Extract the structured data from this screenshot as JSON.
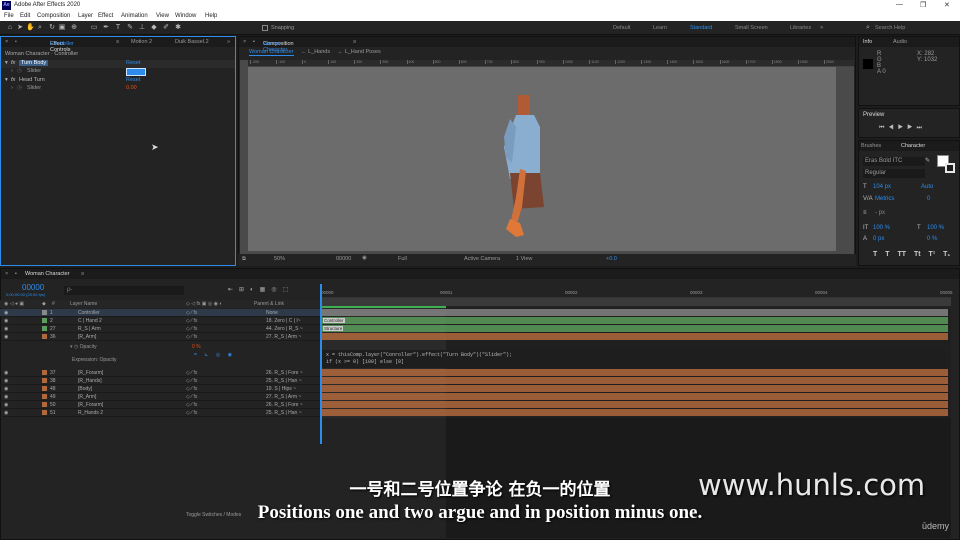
{
  "window": {
    "title": "Adobe After Effects 2020",
    "logo": "Ae"
  },
  "menu": [
    "File",
    "Edit",
    "Composition",
    "Layer",
    "Effect",
    "Animation",
    "View",
    "Window",
    "Help"
  ],
  "toolbar": {
    "snapping_label": "Snapping",
    "workspaces": [
      "Default",
      "Learn",
      "Standard",
      "Small Screen",
      "Libraries"
    ],
    "active_workspace": "Standard",
    "search_placeholder": "Search Help"
  },
  "effect_controls": {
    "tab_prefix": "Effect Controls",
    "tab_layer": "Controller",
    "other_tabs": [
      "Motion 2",
      "Duik Bassel.2"
    ],
    "breadcrumb": "Woman Character · Controller",
    "rows": [
      {
        "label": "Turn Body",
        "value": "Reset"
      },
      {
        "label": "Slider",
        "value": ""
      },
      {
        "label": "Head Turn",
        "value": "Reset"
      },
      {
        "label": "Slider",
        "value": "0.00"
      }
    ]
  },
  "composition": {
    "tab_prefix": "Composition",
    "tab_name": "Woman Character",
    "breadcrumbs": [
      "Woman Character",
      "L_Hands",
      "L_Hand Poses"
    ],
    "ruler_ticks": [
      "-200",
      "-100",
      "0",
      "100",
      "200",
      "300",
      "400",
      "500",
      "600",
      "700",
      "800",
      "900",
      "1000",
      "1100",
      "1200",
      "1300",
      "1400",
      "1500",
      "1600",
      "1700",
      "1800",
      "1900",
      "2000"
    ],
    "footer": {
      "zoom": "50%",
      "time": "00000",
      "resolution": "Full",
      "camera": "Active Camera",
      "views": "1 View",
      "exposure": "+0.0"
    }
  },
  "info_panel": {
    "tabs": [
      "Info",
      "Audio"
    ],
    "x_label": "X",
    "x_value": "282",
    "y_label": "Y",
    "y_value": "1032",
    "channels": [
      "R",
      "G",
      "B",
      "A"
    ],
    "alpha_value": "0"
  },
  "preview_panel": {
    "title": "Preview"
  },
  "character_panel": {
    "tabs": [
      "Brushes",
      "Character"
    ],
    "font_family": "Eras Bold ITC",
    "font_style": "Regular",
    "font_size": "104 px",
    "leading": "Auto",
    "kerning": "Metrics",
    "tracking": "0",
    "stroke_width": "- px",
    "vert_scale": "100 %",
    "horiz_scale": "100 %",
    "baseline": "0 px",
    "tsume": "0 %",
    "style_buttons": [
      "T",
      "T",
      "TT",
      "Tt",
      "T¹",
      "T₁"
    ]
  },
  "timeline": {
    "tab_name": "Woman Character",
    "timecode": "00000",
    "timecode_sub": "0:00:00:00 (25.00 fps)",
    "search_placeholder": "ρ-",
    "col_layer_name": "Layer Name",
    "col_parent": "Parent & Link",
    "time_ruler": [
      "00000",
      "00001",
      "00002",
      "00003",
      "00004",
      "00005"
    ],
    "layers": [
      {
        "num": "1",
        "name": "Controller",
        "parent": "None",
        "color": "#8a8a8a"
      },
      {
        "num": "2",
        "name": "C | Hand 2",
        "parent": "18. Zero | C | I~",
        "color": "#5c9c5c"
      },
      {
        "num": "27",
        "name": "R_S | Arm",
        "parent": "44. Zero | R_S ~",
        "color": "#5c9c5c"
      },
      {
        "num": "36",
        "name": "[R_Arm]",
        "parent": "27. R_S | Arm ~",
        "color": "#b0683c"
      },
      {
        "num": "37",
        "name": "[R_Forarm]",
        "parent": "26. R_S | Fore ~",
        "color": "#b0683c"
      },
      {
        "num": "38",
        "name": "[R_Hands]",
        "parent": "25. R_S | Han ~",
        "color": "#b0683c"
      },
      {
        "num": "48",
        "name": "[Body]",
        "parent": "19. S | Hips ~",
        "color": "#b0683c"
      },
      {
        "num": "49",
        "name": "[R_Arm]",
        "parent": "27. R_S | Arm ~",
        "color": "#b0683c"
      },
      {
        "num": "50",
        "name": "[R_Forarm]",
        "parent": "26. R_S | Fore ~",
        "color": "#b0683c"
      },
      {
        "num": "51",
        "name": "R_Hands 2",
        "parent": "25. R_S | Han ~",
        "color": "#b0683c"
      }
    ],
    "opacity_label": "Opacity",
    "opacity_value": "0 %",
    "expression_label": "Expression: Opacity",
    "expression_code": [
      "x = thisComp.layer(\"Conroller\").effect(\"Turn Body\")(\"Slider\");",
      "if (x >= 0) [100] else [0]"
    ],
    "bar_labels": [
      "Controller",
      "Structure"
    ],
    "toggle_label": "Toggle Switches / Modes"
  },
  "subtitles": {
    "chinese": "一号和二号位置争论 在负一的位置",
    "english": "Positions one and two argue and in position minus one."
  },
  "watermark": "www.hunls.com",
  "brand": "ūdemy"
}
